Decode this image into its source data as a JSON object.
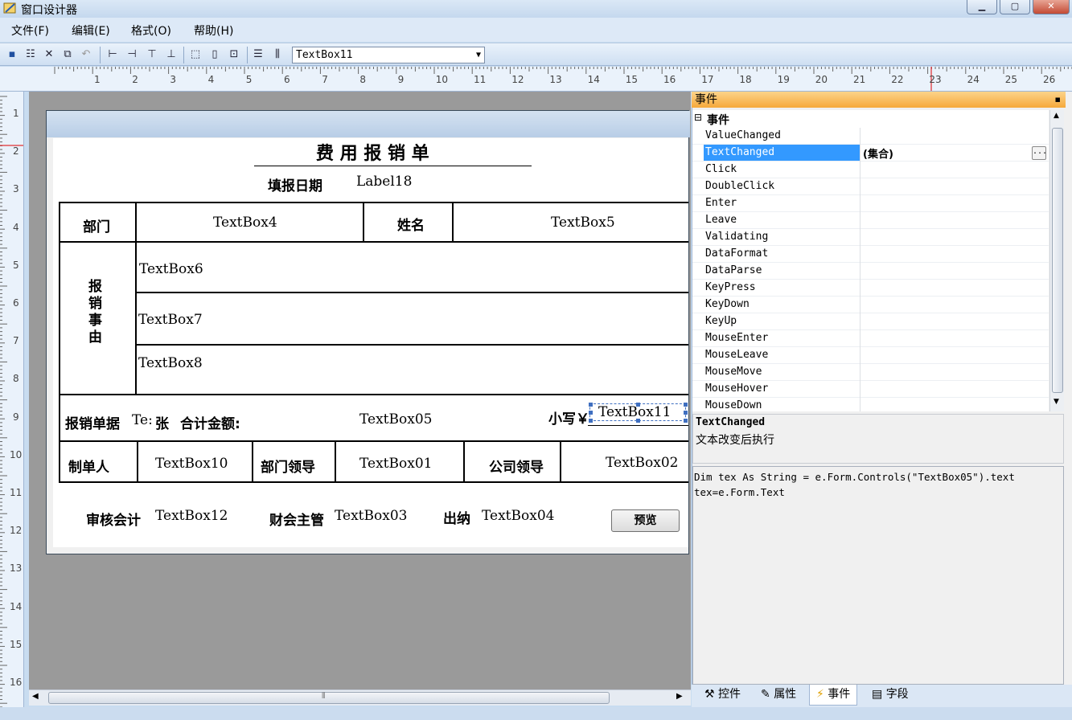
{
  "window": {
    "title": "窗口设计器"
  },
  "menu": [
    "文件(F)",
    "编辑(E)",
    "格式(O)",
    "帮助(H)"
  ],
  "toolbar": {
    "selected_control": "TextBox11"
  },
  "ruler": {
    "h": [
      "1",
      "2",
      "3",
      "4",
      "5",
      "6",
      "7",
      "8",
      "9",
      "10",
      "11",
      "12",
      "13",
      "14",
      "15",
      "16",
      "17",
      "18",
      "19",
      "20",
      "21",
      "22",
      "23",
      "24",
      "25",
      "26"
    ],
    "v": [
      "1",
      "2",
      "3",
      "4",
      "5",
      "6",
      "7",
      "8",
      "9",
      "10",
      "11",
      "12",
      "13",
      "14",
      "15",
      "16"
    ]
  },
  "form": {
    "title": "费 用 报 销 单",
    "date_label": "填报日期",
    "date_value": "Label18",
    "dept_label": "部门",
    "dept_box": "TextBox4",
    "name_label": "姓名",
    "name_box": "TextBox5",
    "reason_label": "报\n销\n事\n由",
    "reason_box1": "TextBox6",
    "reason_box2": "TextBox7",
    "reason_box3": "TextBox8",
    "receipts_label": "报销单据",
    "receipts_box": "Te:",
    "receipts_unit": "张",
    "total_label": "合计金额:",
    "total_box": "TextBox05",
    "small_label": "小写￥",
    "small_box": "TextBox11",
    "maker_label": "制单人",
    "maker_box": "TextBox10",
    "deptlead_label": "部门领导",
    "deptlead_box": "TextBox01",
    "companylead_label": "公司领导",
    "companylead_box": "TextBox02",
    "audit_label": "审核会计",
    "audit_box": "TextBox12",
    "finance_label": "财会主管",
    "finance_box": "TextBox03",
    "cashier_label": "出纳",
    "cashier_box": "TextBox04",
    "preview_button": "预览"
  },
  "panel": {
    "title": "事件",
    "category": "事件",
    "events": [
      "ValueChanged",
      "TextChanged",
      "Click",
      "DoubleClick",
      "Enter",
      "Leave",
      "Validating",
      "DataFormat",
      "DataParse",
      "KeyPress",
      "KeyDown",
      "KeyUp",
      "MouseEnter",
      "MouseLeave",
      "MouseMove",
      "MouseHover",
      "MouseDown"
    ],
    "selected_event": "TextChanged",
    "selected_value": "(集合)",
    "ellipsis": "...",
    "desc_title": "TextChanged",
    "desc_text": "文本改变后执行",
    "code": "Dim tex As String = e.Form.Controls(\"TextBox05\").text\ntex=e.Form.Text",
    "tabs": [
      "控件",
      "属性",
      "事件",
      "字段"
    ],
    "active_tab": "事件"
  },
  "colors": {
    "accent": "#3399ff",
    "panel_title": "#f6a93a"
  }
}
